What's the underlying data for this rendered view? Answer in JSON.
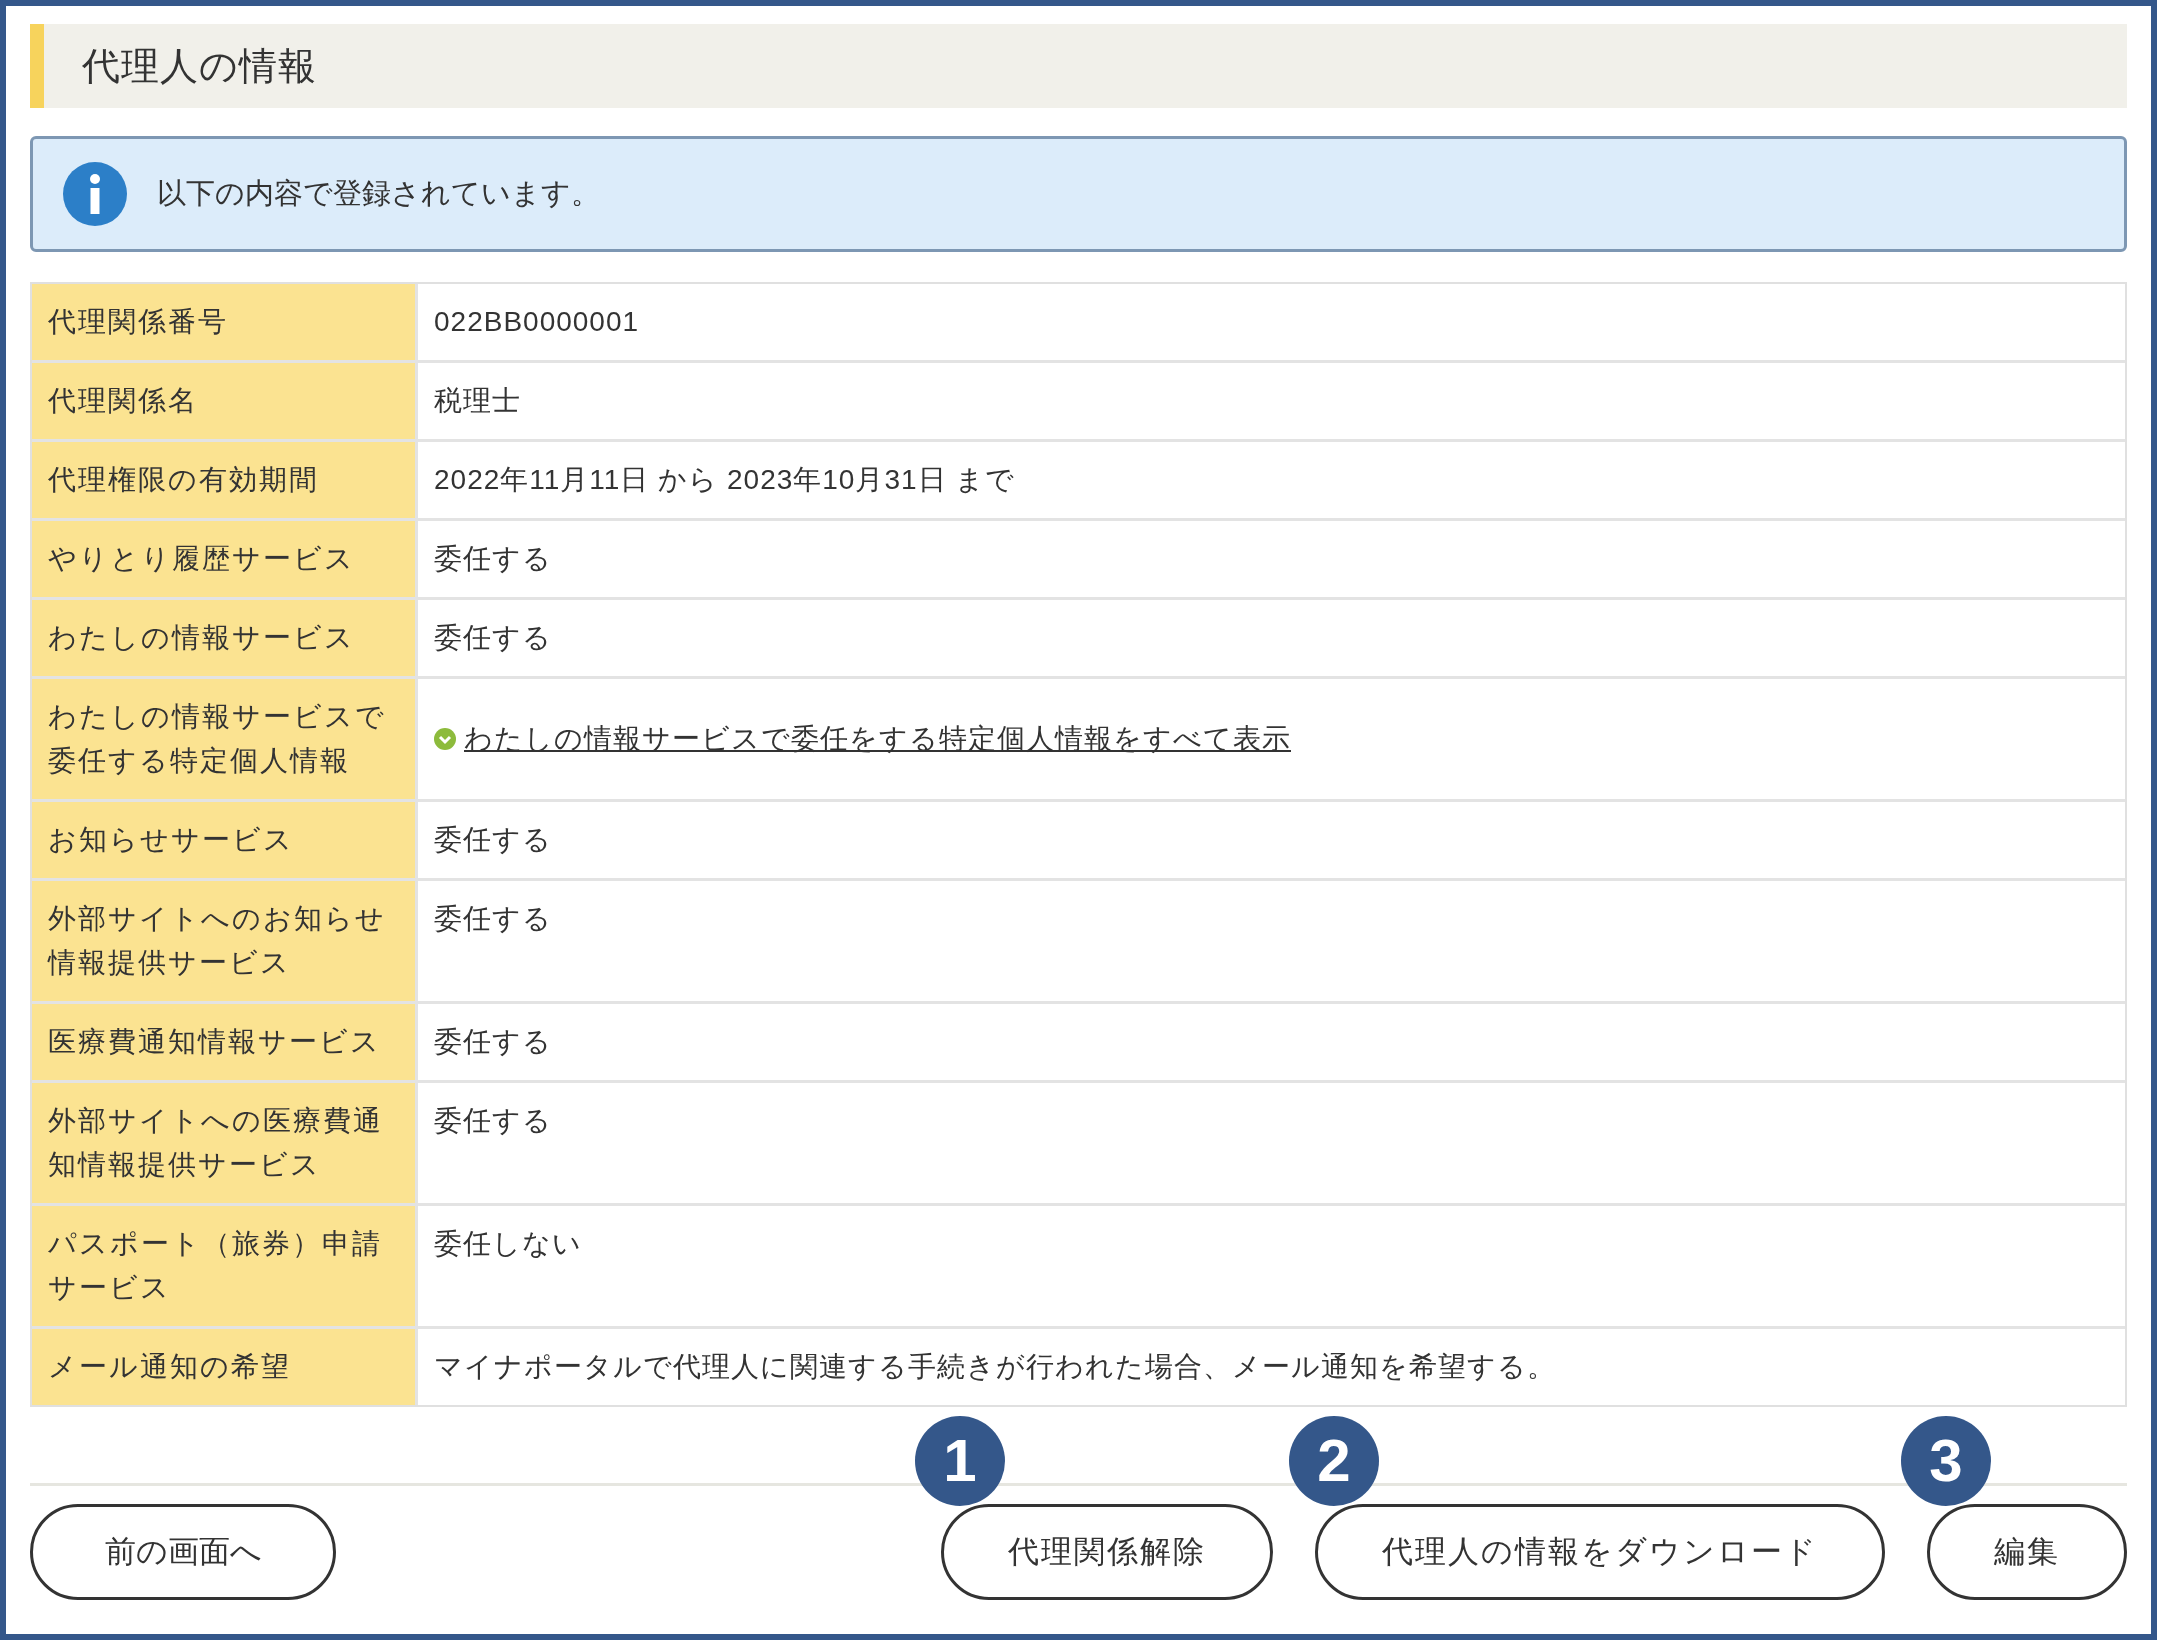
{
  "heading": "代理人の情報",
  "notice": "以下の内容で登録されています。",
  "rows": [
    {
      "label": "代理関係番号",
      "kind": "text",
      "value": "022BB0000001"
    },
    {
      "label": "代理関係名",
      "kind": "text",
      "value": "税理士"
    },
    {
      "label": "代理権限の有効期間",
      "kind": "text",
      "value": "2022年11月11日 から 2023年10月31日 まで"
    },
    {
      "label": "やりとり履歴サービス",
      "kind": "text",
      "value": "委任する"
    },
    {
      "label": "わたしの情報サービス",
      "kind": "text",
      "value": "委任する"
    },
    {
      "label": "わたしの情報サービスで委任する特定個人情報",
      "kind": "link",
      "value": "わたしの情報サービスで委任をする特定個人情報をすべて表示"
    },
    {
      "label": "お知らせサービス",
      "kind": "text",
      "value": "委任する"
    },
    {
      "label": "外部サイトへのお知らせ情報提供サービス",
      "kind": "text",
      "value": "委任する"
    },
    {
      "label": "医療費通知情報サービス",
      "kind": "text",
      "value": "委任する"
    },
    {
      "label": "外部サイトへの医療費通知情報提供サービス",
      "kind": "text",
      "value": "委任する"
    },
    {
      "label": "パスポート（旅券）申請サービス",
      "kind": "text",
      "value": "委任しない"
    },
    {
      "label": "メール通知の希望",
      "kind": "text",
      "value": "マイナポータルで代理人に関連する手続きが行われた場合、メール通知を希望する。"
    }
  ],
  "back_button": "前の画面へ",
  "buttons": [
    {
      "label": "代理関係解除",
      "marker": "1"
    },
    {
      "label": "代理人の情報をダウンロード",
      "marker": "2"
    },
    {
      "label": "編集",
      "marker": "3"
    }
  ]
}
